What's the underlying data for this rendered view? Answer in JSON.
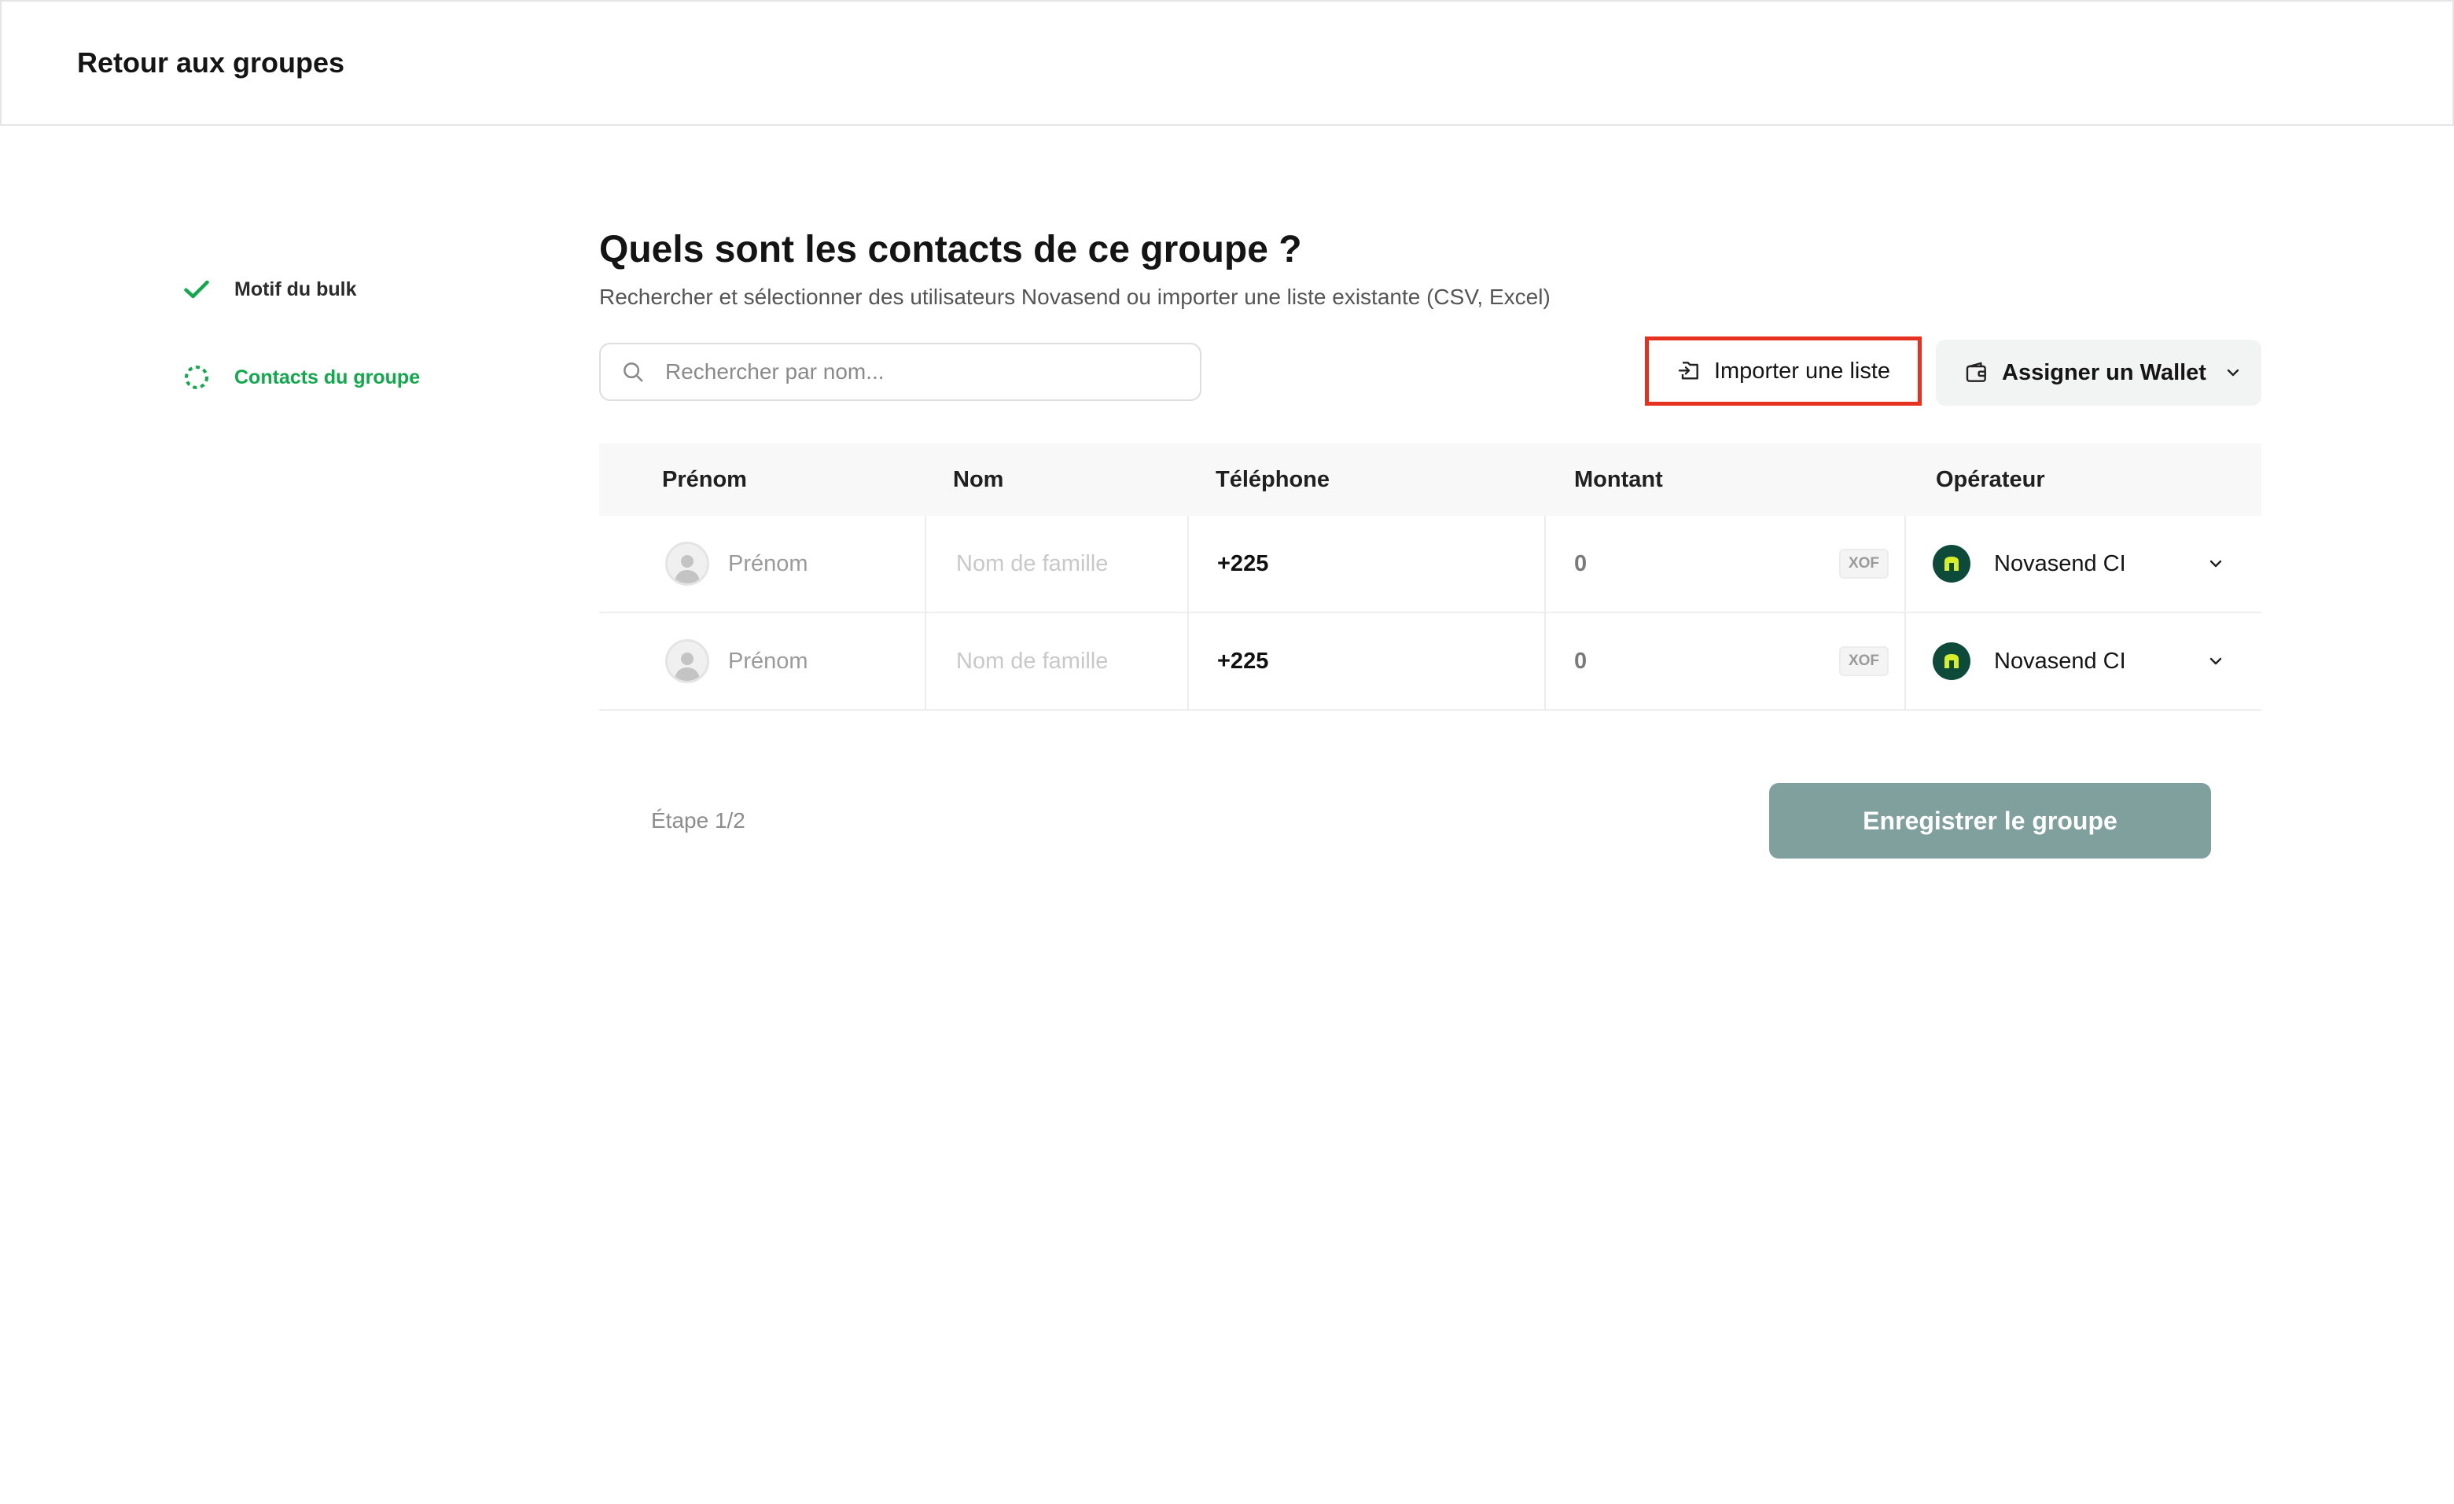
{
  "header": {
    "back_label": "Retour aux groupes"
  },
  "stepper": {
    "steps": [
      {
        "label": "Motif du bulk",
        "status": "done",
        "icon": "check-icon"
      },
      {
        "label": "Contacts du groupe",
        "status": "active",
        "icon": "dashed-circle-icon"
      }
    ]
  },
  "main": {
    "title": "Quels sont les contacts de ce groupe ?",
    "subtitle": "Rechercher et sélectionner des utilisateurs Novasend ou importer une liste existante (CSV, Excel)",
    "search": {
      "placeholder": "Rechercher par nom...",
      "value": ""
    },
    "import_button": {
      "label": "Importer une liste",
      "icon": "file-import-icon"
    },
    "wallet_button": {
      "label": "Assigner un Wallet",
      "icon": "wallet-icon"
    }
  },
  "table": {
    "columns": [
      "Prénom",
      "Nom",
      "Téléphone",
      "Montant",
      "Opérateur"
    ],
    "rows": [
      {
        "first_name_placeholder": "Prénom",
        "last_name_placeholder": "Nom de famille",
        "phone": "+225",
        "amount": "0",
        "currency": "XOF",
        "operator": "Novasend CI"
      },
      {
        "first_name_placeholder": "Prénom",
        "last_name_placeholder": "Nom de famille",
        "phone": "+225",
        "amount": "0",
        "currency": "XOF",
        "operator": "Novasend CI"
      }
    ]
  },
  "footer": {
    "step_text": "Étape 1/2",
    "save_label": "Enregistrer le groupe"
  },
  "colors": {
    "accent_green": "#12a84c",
    "save_button": "#80a09e",
    "highlight_red": "#e5311e",
    "operator_logo": "#0d4a3a"
  }
}
